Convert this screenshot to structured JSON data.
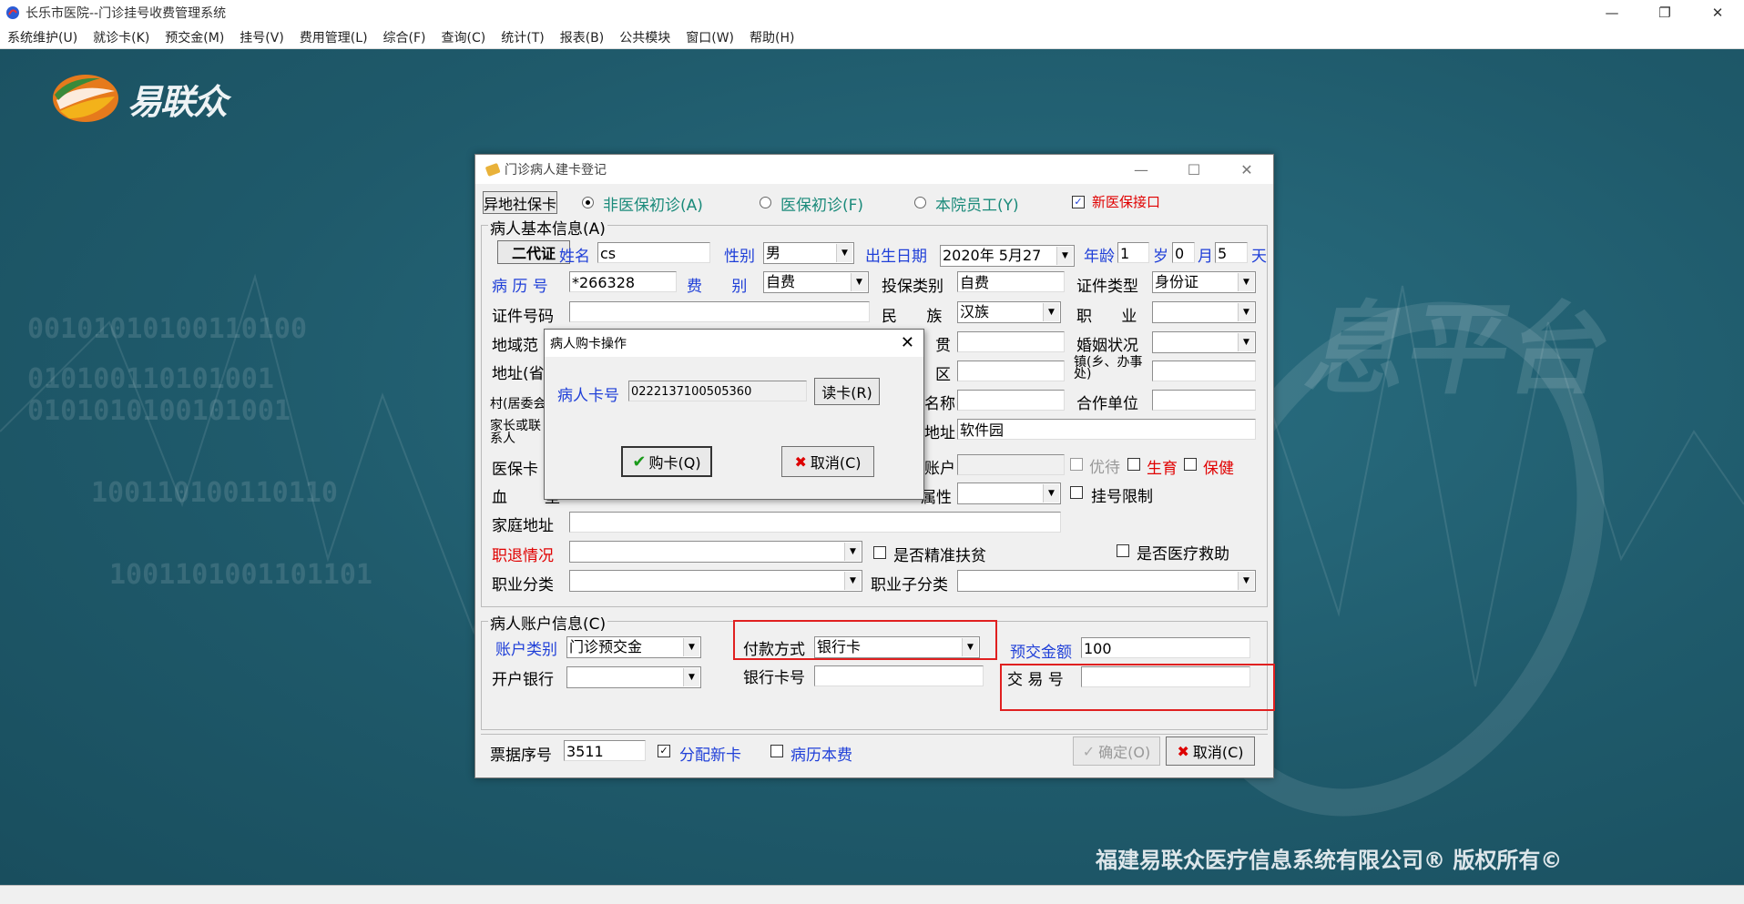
{
  "app": {
    "title": "长乐市医院--门诊挂号收费管理系统",
    "window_buttons": {
      "minimize": "—",
      "restore": "❐",
      "close": "✕"
    }
  },
  "menu": [
    "系统维护(U)",
    "就诊卡(K)",
    "预交金(M)",
    "挂号(V)",
    "费用管理(L)",
    "综合(F)",
    "查询(C)",
    "统计(T)",
    "报表(B)",
    "公共模块",
    "窗口(W)",
    "帮助(H)"
  ],
  "desktop": {
    "logo_text": "易联众",
    "copyright": "福建易联众医疗信息系统有限公司® 版权所有©",
    "bg_big_text": "息平台",
    "bg_binary": [
      "00101010100110100",
      "010100110101001",
      "0101010100101001",
      "100110100110110",
      "1001101001101101"
    ]
  },
  "dialog": {
    "title": "门诊病人建卡登记",
    "btn_offsite_card": "异地社保卡",
    "radio_non_insured": "非医保初诊(A)",
    "radio_insured": "医保初诊(F)",
    "radio_staff": "本院员工(Y)",
    "chk_new_insurance": "新医保接口",
    "group_basic": "病人基本信息(A)",
    "btn_id_card": "二代证",
    "lbl_name": "姓名",
    "val_name": "cs",
    "lbl_gender": "性别",
    "val_gender": "男",
    "lbl_birth": "出生日期",
    "val_birth": "2020年 5月27",
    "lbl_age": "年龄",
    "val_age_year": "1",
    "lbl_year": "岁",
    "val_age_month": "0",
    "lbl_month": "月",
    "val_age_day": "5",
    "lbl_day": "天",
    "lbl_record_no": "病 历 号",
    "val_record_no": "*266328",
    "lbl_fee_type": "费      别",
    "val_fee_type": "自费",
    "lbl_ins_type": "投保类别",
    "val_ins_type": "自费",
    "lbl_cert_type": "证件类型",
    "val_cert_type": "身份证",
    "lbl_cert_no": "证件号码",
    "lbl_nation": "民      族",
    "val_nation": "汉族",
    "lbl_job": "职      业",
    "lbl_region": "地域范",
    "lbl_native": "贯",
    "lbl_marriage": "婚姻状况",
    "lbl_address_prov": "地址(省",
    "lbl_district": "区",
    "lbl_town": "镇(乡、办事处)",
    "lbl_village": "村(居委会",
    "lbl_name2": "名称",
    "lbl_coop": "合作单位",
    "lbl_guardian": "家长或联系人",
    "lbl_addr2": "地址",
    "val_addr2": "软件园",
    "lbl_ins_card": "医保卡",
    "lbl_account": "账户",
    "chk_priority": "优待",
    "chk_birth": "生育",
    "chk_care": "保健",
    "lbl_blood": "血",
    "lbl_blood2": "型",
    "lbl_attr": "属性",
    "chk_reg_limit": "挂号限制",
    "lbl_home_addr": "家庭地址",
    "lbl_retire": "职退情况",
    "chk_poverty": "是否精准扶贫",
    "chk_medical_aid": "是否医疗救助",
    "lbl_job_class": "职业分类",
    "lbl_job_subclass": "职业子分类",
    "group_account": "病人账户信息(C)",
    "lbl_account_type": "账户类别",
    "val_account_type": "门诊预交金",
    "lbl_pay_method": "付款方式",
    "val_pay_method": "银行卡",
    "lbl_prepay": "预交金额",
    "val_prepay": "100",
    "lbl_bank": "开户银行",
    "lbl_bank_card": "银行卡号",
    "lbl_trade_no": "交 易 号",
    "lbl_receipt_no": "票据序号",
    "val_receipt_no": "3511",
    "chk_assign_card": "分配新卡",
    "chk_record_fee": "病历本费",
    "btn_ok": "确定(O)",
    "btn_cancel": "取消(C)"
  },
  "subdialog": {
    "title": "病人购卡操作",
    "lbl_card_no": "病人卡号",
    "val_card_no": "0222137100505360",
    "btn_read": "读卡(R)",
    "btn_buy": "购卡(Q)",
    "btn_cancel": "取消(C)"
  },
  "colors": {
    "desktop_bg": "#1f5a6b",
    "label_blue": "#1f3fd8",
    "label_red": "#e00000",
    "highlight_box": "#e02020"
  }
}
